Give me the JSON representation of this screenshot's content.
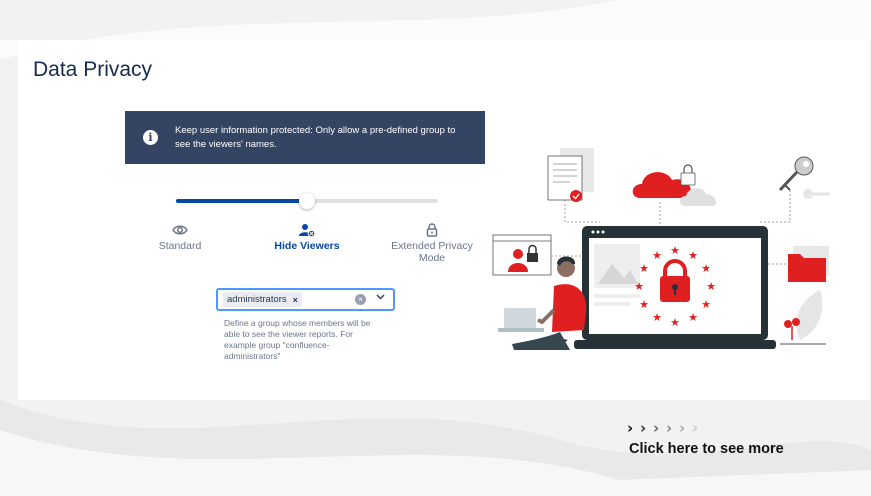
{
  "page": {
    "title": "Data Privacy"
  },
  "banner": {
    "icon": "info-icon",
    "text": "Keep user information protected: Only allow a pre-defined group to see the viewers' names."
  },
  "slider": {
    "value_percent": 50,
    "accent": "#0747a6"
  },
  "modes": [
    {
      "label": "Standard",
      "icon": "eye-icon",
      "active": false
    },
    {
      "label": "Hide Viewers",
      "icon": "user-hidden-icon",
      "active": true
    },
    {
      "label": "Extended Privacy Mode",
      "icon": "lock-icon",
      "active": false
    }
  ],
  "group_select": {
    "selected": "administrators",
    "remove_glyph": "×",
    "clear_glyph": "×",
    "helper": "Define a group whose members will be able to see the viewer reports. For example group \"confluence-administrators\""
  },
  "cta": {
    "chevrons": [
      "›",
      "›",
      "›",
      "›",
      "›",
      "›"
    ],
    "label": "Click here to see more"
  },
  "colors": {
    "banner_bg": "#344563",
    "brand_red": "#e02020",
    "select_border": "#4c9aff"
  }
}
